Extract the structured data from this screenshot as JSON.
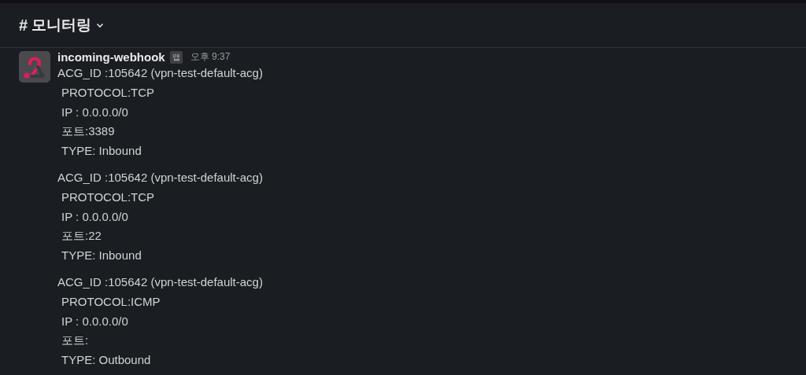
{
  "channel": {
    "prefix": "#",
    "name": "모니터링"
  },
  "message": {
    "author": "incoming-webhook",
    "badge": "앱",
    "time": "오후 9:37",
    "blocks": [
      {
        "header": "ACG_ID :105642 (vpn-test-default-acg)",
        "details": [
          "PROTOCOL:TCP",
          "IP : 0.0.0.0/0",
          "포트:3389",
          "TYPE: Inbound"
        ]
      },
      {
        "header": "ACG_ID :105642 (vpn-test-default-acg)",
        "details": [
          "PROTOCOL:TCP",
          "IP : 0.0.0.0/0",
          "포트:22",
          "TYPE: Inbound"
        ]
      },
      {
        "header": "ACG_ID :105642 (vpn-test-default-acg)",
        "details": [
          "PROTOCOL:ICMP",
          "IP : 0.0.0.0/0",
          "포트:",
          "TYPE: Outbound"
        ]
      }
    ]
  }
}
